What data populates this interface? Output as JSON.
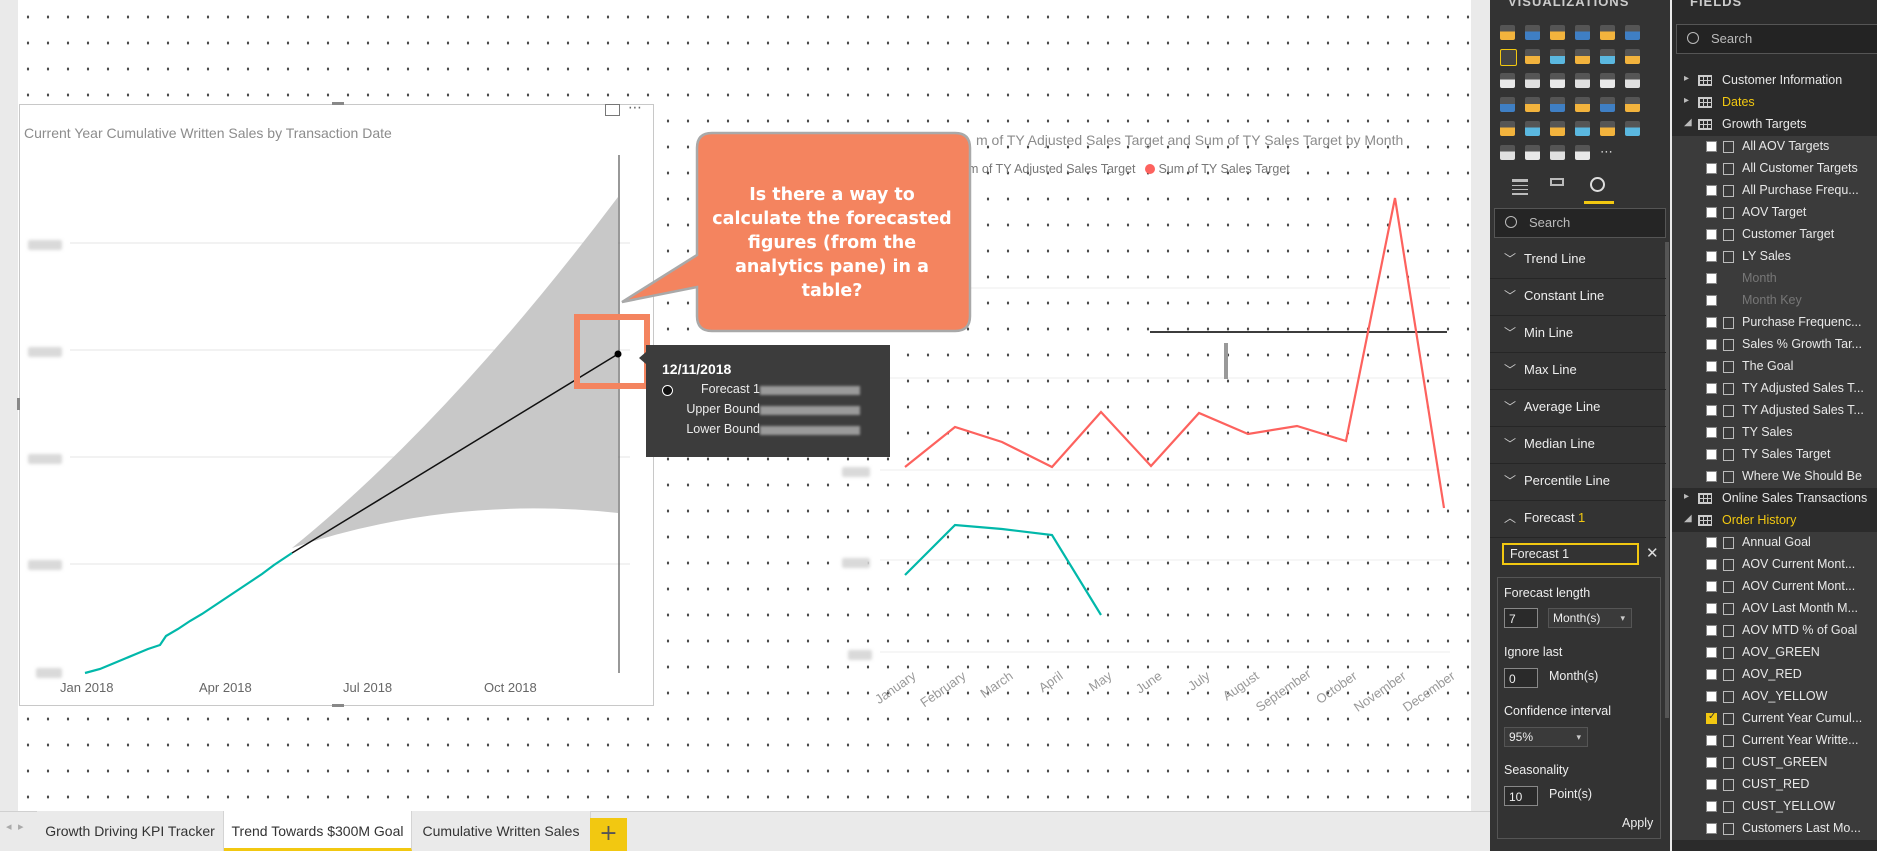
{
  "left_chart": {
    "title": "Current Year Cumulative Written Sales by Transaction Date",
    "x_ticks": [
      "Jan 2018",
      "Apr 2018",
      "Jul 2018",
      "Oct 2018"
    ]
  },
  "right_chart": {
    "title": "m of TY Adjusted Sales Target and Sum of TY Sales Target by Month",
    "legend": [
      {
        "label": "m of TY Adjusted Sales Target",
        "color": "#01b8aa"
      },
      {
        "label": "Sum of TY Sales Target",
        "color": "#fd625e"
      }
    ],
    "months": [
      "January",
      "February",
      "March",
      "April",
      "May",
      "June",
      "July",
      "August",
      "September",
      "October",
      "November",
      "December"
    ]
  },
  "callout": {
    "text": "Is there a way to calculate the forecasted figures (from the analytics pane) in a table?"
  },
  "tooltip": {
    "date": "12/11/2018",
    "rows": [
      "Forecast 1",
      "Upper Bound",
      "Lower Bound"
    ]
  },
  "tabs": {
    "items": [
      "Growth Driving KPI Tracker",
      "Trend Towards $300M Goal",
      "Cumulative Written Sales"
    ],
    "active_index": 1,
    "add_label": "+"
  },
  "viz_panel": {
    "heading": "VISUALIZATIONS",
    "search_placeholder": "Search",
    "analytics_items": [
      "Trend Line",
      "Constant Line",
      "Min Line",
      "Max Line",
      "Average Line",
      "Median Line",
      "Percentile Line"
    ],
    "forecast": {
      "label": "Forecast",
      "count": "1",
      "name": "Forecast 1",
      "length_label": "Forecast length",
      "length_value": "7",
      "length_unit": "Month(s)",
      "ignore_label": "Ignore last",
      "ignore_value": "0",
      "ignore_unit": "Month(s)",
      "confidence_label": "Confidence interval",
      "confidence_value": "95%",
      "seasonality_label": "Seasonality",
      "seasonality_value": "10",
      "seasonality_unit": "Point(s)",
      "apply_label": "Apply"
    }
  },
  "fields_panel": {
    "heading": "FIELDS",
    "search_placeholder": "Search",
    "tables_top": [
      "Customer Information",
      "Dates",
      "Growth Targets"
    ],
    "growth_fields": [
      "All AOV Targets",
      "All Customer Targets",
      "All Purchase Frequ...",
      "AOV Target",
      "Customer Target",
      "LY Sales",
      "Month",
      "Month Key",
      "Purchase Frequenc...",
      "Sales % Growth Tar...",
      "The Goal",
      "TY Adjusted Sales T...",
      "TY Adjusted Sales T...",
      "TY Sales",
      "TY Sales Target",
      "Where We Should Be"
    ],
    "tables_mid": [
      "Online Sales Transactions",
      "Order History"
    ],
    "order_fields": [
      "Annual Goal",
      "AOV Current Mont...",
      "AOV Current Mont...",
      "AOV Last Month M...",
      "AOV MTD % of Goal",
      "AOV_GREEN",
      "AOV_RED",
      "AOV_YELLOW",
      "Current Year Cumul...",
      "Current Year Writte...",
      "CUST_GREEN",
      "CUST_RED",
      "CUST_YELLOW",
      "Customers Last Mo..."
    ]
  }
}
